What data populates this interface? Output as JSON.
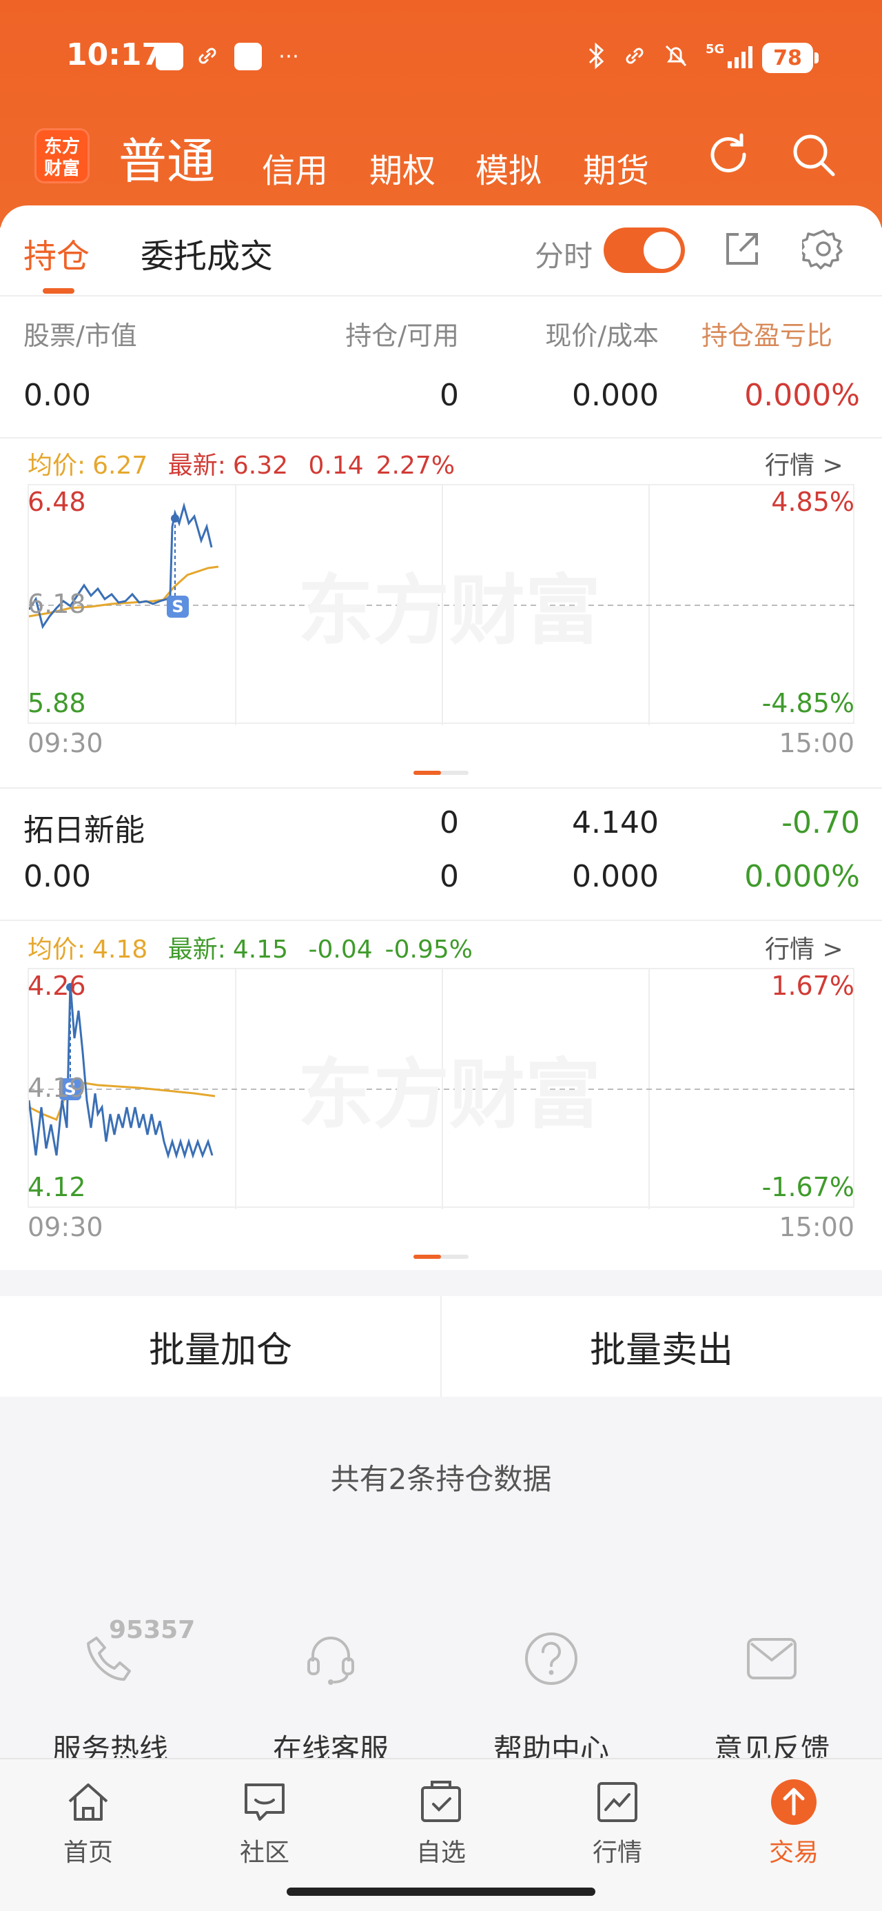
{
  "status_bar": {
    "time": "10:17",
    "battery": "78",
    "network": "5G"
  },
  "header": {
    "logo_text": "东方财富",
    "account_type_active": "普通",
    "account_types": [
      "信用",
      "期权",
      "模拟",
      "期货"
    ]
  },
  "tabs": {
    "positions": "持仓",
    "orders": "委托成交"
  },
  "timeshare": {
    "label": "分时",
    "enabled": true
  },
  "table_headers": {
    "col1": "股票/市值",
    "col2": "持仓/可用",
    "col3": "现价/成本",
    "col4": "持仓盈亏比"
  },
  "summary_row": {
    "value": "0.00",
    "position": "0",
    "price": "0.000",
    "pl_ratio": "0.000%"
  },
  "stocks": [
    {
      "name": "",
      "avg_label": "均价:",
      "avg_price": "6.27",
      "latest_label": "最新:",
      "latest_price": "6.32",
      "change": "0.14",
      "change_pct": "2.27%",
      "quote_link": "行情 >",
      "chart": {
        "y_top": "6.48",
        "y_mid": "6.18",
        "y_bottom": "5.88",
        "pct_top": "4.85%",
        "pct_bottom": "-4.85%",
        "time_start": "09:30",
        "time_end": "15:00",
        "trade_marker": "S"
      }
    },
    {
      "name": "拓日新能",
      "position": "0",
      "price": "4.140",
      "pl": "-0.70",
      "value": "0.00",
      "available": "0",
      "cost": "0.000",
      "pl_ratio": "0.000%",
      "avg_label": "均价:",
      "avg_price": "4.18",
      "latest_label": "最新:",
      "latest_price": "4.15",
      "change": "-0.04",
      "change_pct": "-0.95%",
      "quote_link": "行情 >",
      "chart": {
        "y_top": "4.26",
        "y_mid": "4.19",
        "y_bottom": "4.12",
        "pct_top": "1.67%",
        "pct_bottom": "-1.67%",
        "time_start": "09:30",
        "time_end": "15:00",
        "trade_marker": "S"
      }
    }
  ],
  "watermark": "东方财富",
  "batch": {
    "add": "批量加仓",
    "sell": "批量卖出"
  },
  "summary_text": "共有2条持仓数据",
  "services": {
    "hotline": "服务热线",
    "hotline_number": "95357",
    "online": "在线客服",
    "help": "帮助中心",
    "feedback": "意见反馈"
  },
  "tabbar": [
    {
      "label": "首页",
      "icon": "home-icon"
    },
    {
      "label": "社区",
      "icon": "community-icon"
    },
    {
      "label": "自选",
      "icon": "watchlist-icon"
    },
    {
      "label": "行情",
      "icon": "market-icon"
    },
    {
      "label": "交易",
      "icon": "trade-icon",
      "active": true
    }
  ],
  "colors": {
    "brand": "#ef6327",
    "up": "#d13b35",
    "down": "#3f9b2b",
    "avg_line": "#e5a72d",
    "price_line": "#3a6fb5"
  }
}
